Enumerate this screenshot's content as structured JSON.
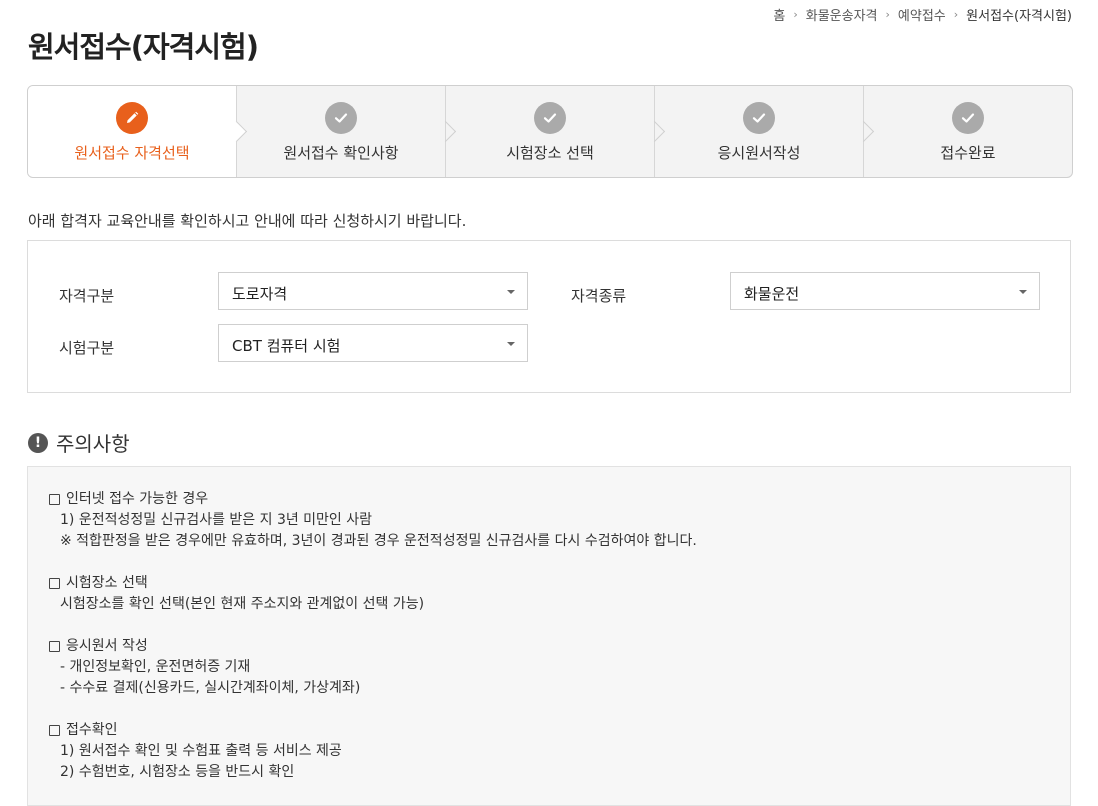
{
  "breadcrumb": [
    "홈",
    "화물운송자격",
    "예약접수",
    "원서접수(자격시험)"
  ],
  "page_title": "원서접수(자격시험)",
  "steps": [
    {
      "label": "원서접수 자격선택",
      "state": "active",
      "icon": "pencil-icon"
    },
    {
      "label": "원서접수 확인사항",
      "state": "pending",
      "icon": "check-icon"
    },
    {
      "label": "시험장소 선택",
      "state": "pending",
      "icon": "check-icon"
    },
    {
      "label": "응시원서작성",
      "state": "pending",
      "icon": "check-icon"
    },
    {
      "label": "접수완료",
      "state": "pending",
      "icon": "check-icon"
    }
  ],
  "intro": "아래 합격자 교육안내를 확인하시고 안내에 따라 신청하시기 바랍니다.",
  "form": {
    "qual_category_label": "자격구분",
    "qual_category_value": "도로자격",
    "qual_type_label": "자격종류",
    "qual_type_value": "화물운전",
    "exam_category_label": "시험구분",
    "exam_category_value": "CBT 컴퓨터 시험"
  },
  "notice": {
    "title": "주의사항",
    "groups": [
      {
        "heading": "인터넷 접수 가능한 경우",
        "lines": [
          "1) 운전적성정밀 신규검사를 받은 지 3년 미만인 사람",
          "※ 적합판정을 받은 경우에만 유효하며, 3년이 경과된 경우 운전적성정밀 신규검사를 다시 수검하여야 합니다."
        ]
      },
      {
        "heading": "시험장소 선택",
        "lines": [
          "시험장소를 확인 선택(본인 현재 주소지와 관계없이 선택 가능)"
        ]
      },
      {
        "heading": "응시원서 작성",
        "lines": [
          "- 개인정보확인, 운전면허증 기재",
          "- 수수료 결제(신용카드, 실시간계좌이체, 가상계좌)"
        ]
      },
      {
        "heading": "접수확인",
        "lines": [
          "1) 원서접수 확인 및 수험표 출력 등 서비스 제공",
          "2) 수험번호, 시험장소 등을 반드시 확인"
        ]
      }
    ]
  },
  "colors": {
    "accent": "#e8601c",
    "step_inactive": "#aaaaaa"
  }
}
